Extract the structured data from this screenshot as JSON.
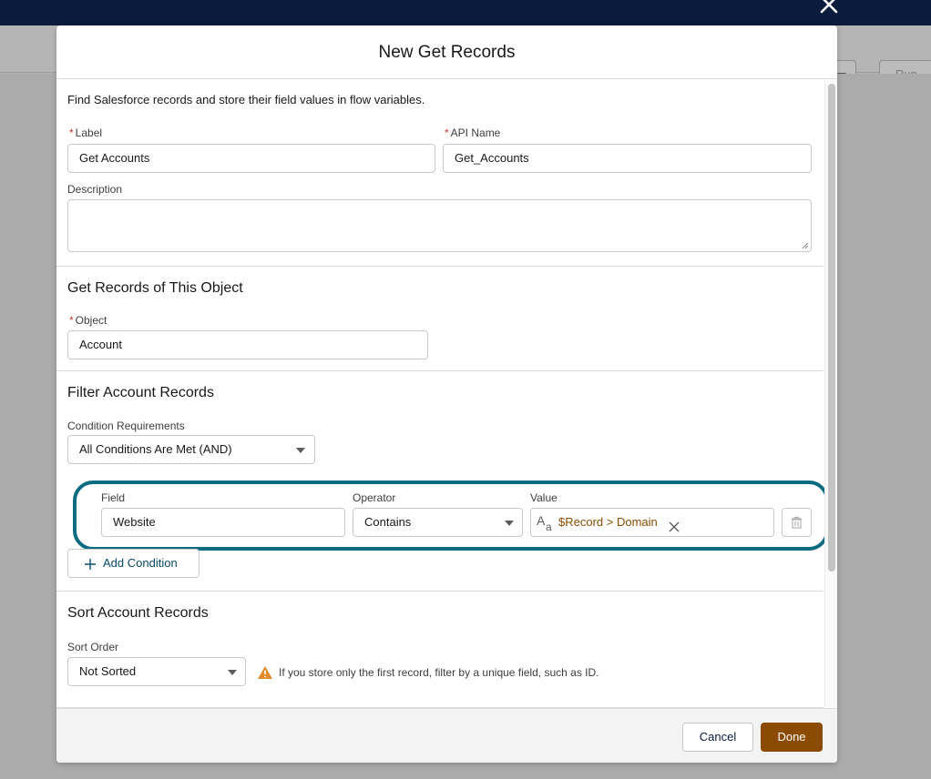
{
  "modal": {
    "title": "New Get Records",
    "description": "Find Salesforce records and store their field values in flow variables."
  },
  "general": {
    "label": {
      "label": "Label",
      "value": "Get Accounts"
    },
    "api_name": {
      "label": "API Name",
      "value": "Get_Accounts"
    },
    "description": {
      "label": "Description",
      "value": ""
    }
  },
  "object_section": {
    "title": "Get Records of This Object",
    "object_label": "Object",
    "object_value": "Account"
  },
  "filter_section": {
    "title": "Filter Account Records",
    "condition_req_label": "Condition Requirements",
    "condition_req_value": "All Conditions Are Met (AND)",
    "field_label": "Field",
    "field_value": "Website",
    "operator_label": "Operator",
    "operator_value": "Contains",
    "value_label": "Value",
    "value_pill": "$Record > Domain",
    "add_condition": "Add Condition"
  },
  "sort_section": {
    "title": "Sort Account Records",
    "sort_order_label": "Sort Order",
    "sort_order_value": "Not Sorted",
    "warning": "If you store only the first record, filter by a unique field, such as ID."
  },
  "footer": {
    "cancel": "Cancel",
    "done": "Done"
  },
  "background": {
    "run": "Run"
  },
  "colors": {
    "brand": "#8c4b02",
    "highlight": "#0b6b80",
    "required": "#c23934"
  }
}
